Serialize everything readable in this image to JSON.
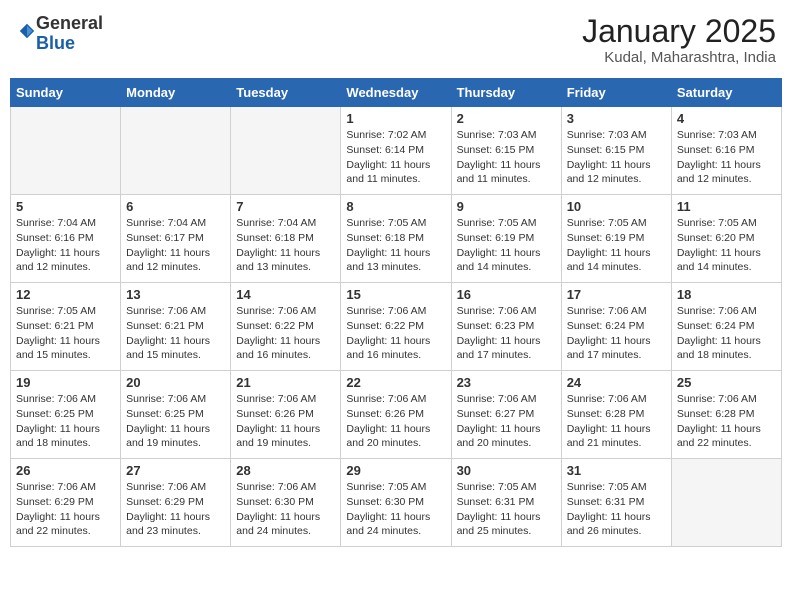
{
  "header": {
    "logo_general": "General",
    "logo_blue": "Blue",
    "month_year": "January 2025",
    "location": "Kudal, Maharashtra, India"
  },
  "weekdays": [
    "Sunday",
    "Monday",
    "Tuesday",
    "Wednesday",
    "Thursday",
    "Friday",
    "Saturday"
  ],
  "weeks": [
    [
      {
        "day": "",
        "empty": true
      },
      {
        "day": "",
        "empty": true
      },
      {
        "day": "",
        "empty": true
      },
      {
        "day": "1",
        "sunrise": "7:02 AM",
        "sunset": "6:14 PM",
        "daylight": "11 hours and 11 minutes."
      },
      {
        "day": "2",
        "sunrise": "7:03 AM",
        "sunset": "6:15 PM",
        "daylight": "11 hours and 11 minutes."
      },
      {
        "day": "3",
        "sunrise": "7:03 AM",
        "sunset": "6:15 PM",
        "daylight": "11 hours and 12 minutes."
      },
      {
        "day": "4",
        "sunrise": "7:03 AM",
        "sunset": "6:16 PM",
        "daylight": "11 hours and 12 minutes."
      }
    ],
    [
      {
        "day": "5",
        "sunrise": "7:04 AM",
        "sunset": "6:16 PM",
        "daylight": "11 hours and 12 minutes."
      },
      {
        "day": "6",
        "sunrise": "7:04 AM",
        "sunset": "6:17 PM",
        "daylight": "11 hours and 12 minutes."
      },
      {
        "day": "7",
        "sunrise": "7:04 AM",
        "sunset": "6:18 PM",
        "daylight": "11 hours and 13 minutes."
      },
      {
        "day": "8",
        "sunrise": "7:05 AM",
        "sunset": "6:18 PM",
        "daylight": "11 hours and 13 minutes."
      },
      {
        "day": "9",
        "sunrise": "7:05 AM",
        "sunset": "6:19 PM",
        "daylight": "11 hours and 14 minutes."
      },
      {
        "day": "10",
        "sunrise": "7:05 AM",
        "sunset": "6:19 PM",
        "daylight": "11 hours and 14 minutes."
      },
      {
        "day": "11",
        "sunrise": "7:05 AM",
        "sunset": "6:20 PM",
        "daylight": "11 hours and 14 minutes."
      }
    ],
    [
      {
        "day": "12",
        "sunrise": "7:05 AM",
        "sunset": "6:21 PM",
        "daylight": "11 hours and 15 minutes."
      },
      {
        "day": "13",
        "sunrise": "7:06 AM",
        "sunset": "6:21 PM",
        "daylight": "11 hours and 15 minutes."
      },
      {
        "day": "14",
        "sunrise": "7:06 AM",
        "sunset": "6:22 PM",
        "daylight": "11 hours and 16 minutes."
      },
      {
        "day": "15",
        "sunrise": "7:06 AM",
        "sunset": "6:22 PM",
        "daylight": "11 hours and 16 minutes."
      },
      {
        "day": "16",
        "sunrise": "7:06 AM",
        "sunset": "6:23 PM",
        "daylight": "11 hours and 17 minutes."
      },
      {
        "day": "17",
        "sunrise": "7:06 AM",
        "sunset": "6:24 PM",
        "daylight": "11 hours and 17 minutes."
      },
      {
        "day": "18",
        "sunrise": "7:06 AM",
        "sunset": "6:24 PM",
        "daylight": "11 hours and 18 minutes."
      }
    ],
    [
      {
        "day": "19",
        "sunrise": "7:06 AM",
        "sunset": "6:25 PM",
        "daylight": "11 hours and 18 minutes."
      },
      {
        "day": "20",
        "sunrise": "7:06 AM",
        "sunset": "6:25 PM",
        "daylight": "11 hours and 19 minutes."
      },
      {
        "day": "21",
        "sunrise": "7:06 AM",
        "sunset": "6:26 PM",
        "daylight": "11 hours and 19 minutes."
      },
      {
        "day": "22",
        "sunrise": "7:06 AM",
        "sunset": "6:26 PM",
        "daylight": "11 hours and 20 minutes."
      },
      {
        "day": "23",
        "sunrise": "7:06 AM",
        "sunset": "6:27 PM",
        "daylight": "11 hours and 20 minutes."
      },
      {
        "day": "24",
        "sunrise": "7:06 AM",
        "sunset": "6:28 PM",
        "daylight": "11 hours and 21 minutes."
      },
      {
        "day": "25",
        "sunrise": "7:06 AM",
        "sunset": "6:28 PM",
        "daylight": "11 hours and 22 minutes."
      }
    ],
    [
      {
        "day": "26",
        "sunrise": "7:06 AM",
        "sunset": "6:29 PM",
        "daylight": "11 hours and 22 minutes."
      },
      {
        "day": "27",
        "sunrise": "7:06 AM",
        "sunset": "6:29 PM",
        "daylight": "11 hours and 23 minutes."
      },
      {
        "day": "28",
        "sunrise": "7:06 AM",
        "sunset": "6:30 PM",
        "daylight": "11 hours and 24 minutes."
      },
      {
        "day": "29",
        "sunrise": "7:05 AM",
        "sunset": "6:30 PM",
        "daylight": "11 hours and 24 minutes."
      },
      {
        "day": "30",
        "sunrise": "7:05 AM",
        "sunset": "6:31 PM",
        "daylight": "11 hours and 25 minutes."
      },
      {
        "day": "31",
        "sunrise": "7:05 AM",
        "sunset": "6:31 PM",
        "daylight": "11 hours and 26 minutes."
      },
      {
        "day": "",
        "empty": true
      }
    ]
  ],
  "labels": {
    "sunrise": "Sunrise:",
    "sunset": "Sunset:",
    "daylight": "Daylight:"
  }
}
